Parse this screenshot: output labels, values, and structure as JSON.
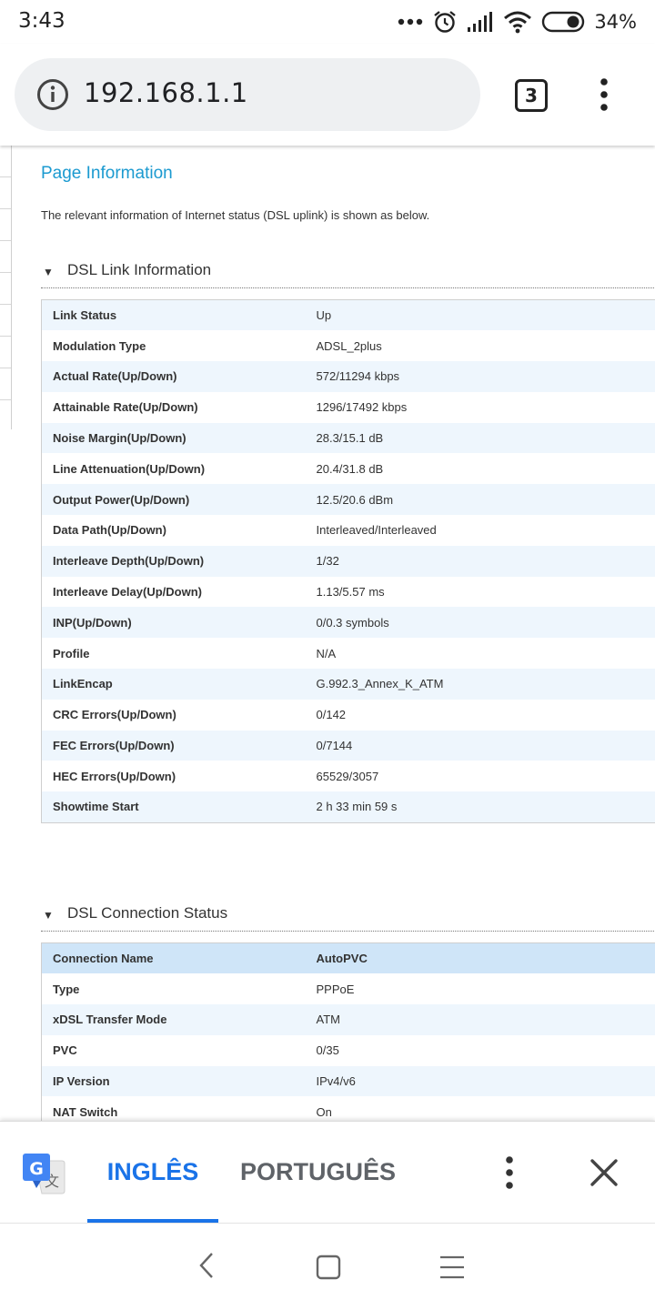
{
  "status_bar": {
    "time": "3:43",
    "battery": "34%",
    "icons": [
      "more-dots-icon",
      "alarm-icon",
      "signal-icon",
      "wifi-icon",
      "battery-icon"
    ]
  },
  "browser": {
    "url": "192.168.1.1",
    "tab_count": "3",
    "icons": [
      "info-icon",
      "tab-switcher-icon",
      "overflow-menu-icon"
    ]
  },
  "page": {
    "title": "Page Information",
    "description": "The relevant information of Internet status (DSL uplink) is shown as below.",
    "dsl_link": {
      "heading": "DSL Link Information",
      "rows": [
        {
          "label": "Link Status",
          "value": "Up"
        },
        {
          "label": "Modulation Type",
          "value": "ADSL_2plus"
        },
        {
          "label": "Actual Rate(Up/Down)",
          "value": "572/11294 kbps"
        },
        {
          "label": "Attainable Rate(Up/Down)",
          "value": "1296/17492 kbps"
        },
        {
          "label": "Noise Margin(Up/Down)",
          "value": "28.3/15.1 dB"
        },
        {
          "label": "Line Attenuation(Up/Down)",
          "value": "20.4/31.8 dB"
        },
        {
          "label": "Output Power(Up/Down)",
          "value": "12.5/20.6 dBm"
        },
        {
          "label": "Data Path(Up/Down)",
          "value": "Interleaved/Interleaved"
        },
        {
          "label": "Interleave Depth(Up/Down)",
          "value": "1/32"
        },
        {
          "label": "Interleave Delay(Up/Down)",
          "value": "1.13/5.57 ms"
        },
        {
          "label": "INP(Up/Down)",
          "value": "0/0.3 symbols"
        },
        {
          "label": "Profile",
          "value": "N/A"
        },
        {
          "label": "LinkEncap",
          "value": "G.992.3_Annex_K_ATM"
        },
        {
          "label": "CRC Errors(Up/Down)",
          "value": "0/142"
        },
        {
          "label": "FEC Errors(Up/Down)",
          "value": "0/7144"
        },
        {
          "label": "HEC Errors(Up/Down)",
          "value": "65529/3057"
        },
        {
          "label": "Showtime Start",
          "value": "2 h 33 min 59 s"
        }
      ]
    },
    "dsl_connection": {
      "heading": "DSL Connection Status",
      "header_row": {
        "label": "Connection Name",
        "value": "AutoPVC"
      },
      "rows": [
        {
          "label": "Type",
          "value": "PPPoE"
        },
        {
          "label": "xDSL Transfer Mode",
          "value": "ATM"
        },
        {
          "label": "PVC",
          "value": "0/35"
        },
        {
          "label": "IP Version",
          "value": "IPv4/v6"
        },
        {
          "label": "NAT Switch",
          "value": "On"
        }
      ]
    }
  },
  "translate_bar": {
    "source_language": "INGLÊS",
    "target_language": "PORTUGUÊS",
    "icons": [
      "google-translate-icon",
      "more-vert-icon",
      "close-icon"
    ],
    "accent_color": "#1a73e8"
  },
  "nav_bar": {
    "icons": [
      "back-icon",
      "home-icon",
      "recents-icon"
    ]
  }
}
